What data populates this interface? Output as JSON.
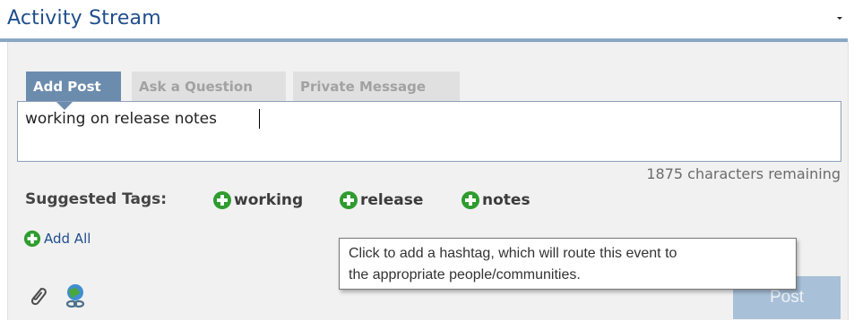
{
  "header": {
    "title": "Activity Stream"
  },
  "composer": {
    "tabs": [
      {
        "label": "Add Post"
      },
      {
        "label": "Ask a Question"
      },
      {
        "label": "Private Message"
      }
    ],
    "input_value": "working on release notes ",
    "chars_remaining": "1875 characters remaining",
    "suggested_label": "Suggested Tags:",
    "tags": [
      {
        "label": "working"
      },
      {
        "label": "release"
      },
      {
        "label": "notes"
      }
    ],
    "add_all_label": "Add All",
    "tooltip": {
      "line1": "Click to add a hashtag, which will route this event to",
      "line2": "the appropriate people/communities."
    },
    "post_label": "Post"
  },
  "colors": {
    "tab_active": "#6c8cae",
    "tag_icon_green": "#2e9c2e",
    "post_button": "#a8c0d8",
    "header_rule": "#8aa8c4"
  },
  "icons": {
    "header_menu": "chevron-down-icon",
    "tag_add": "plus-circle-icon",
    "attach": "paperclip-icon",
    "link": "globe-link-icon"
  }
}
